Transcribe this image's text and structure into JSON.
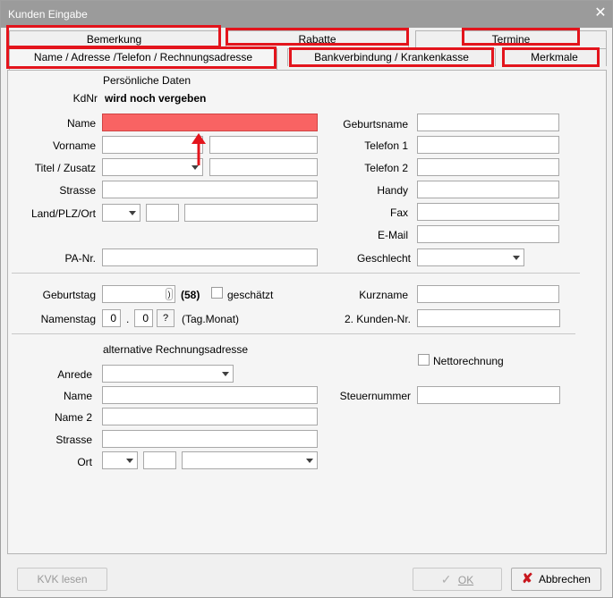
{
  "window": {
    "title": "Kunden Eingabe"
  },
  "tabs": {
    "row1": [
      "Bemerkung",
      "Rabatte",
      "Termine"
    ],
    "row2": [
      "Name / Adresse /Telefon / Rechnungsadresse",
      "Bankverbindung / Krankenkasse",
      "Merkmale"
    ]
  },
  "personal": {
    "section_title": "Persönliche Daten",
    "kdnr_label": "KdNr",
    "kdnr_value": "wird noch vergeben",
    "name_label": "Name",
    "vorname_label": "Vorname",
    "titel_label": "Titel / Zusatz",
    "strasse_label": "Strasse",
    "land_label": "Land/PLZ/Ort",
    "pa_label": "PA-Nr."
  },
  "right_fields": {
    "geburtsname": "Geburtsname",
    "telefon1": "Telefon 1",
    "telefon2": "Telefon 2",
    "handy": "Handy",
    "fax": "Fax",
    "email": "E-Mail",
    "geschlecht": "Geschlecht"
  },
  "dates": {
    "geburtstag_label": "Geburtstag",
    "age": "(58)",
    "geschaetzt_label": "geschätzt",
    "namenstag_label": "Namenstag",
    "namenstag_day": "0",
    "namenstag_sep": ".",
    "namenstag_month": "0",
    "help_button": "?",
    "tag_monat_hint": "(Tag.Monat)",
    "kurzname_label": "Kurzname",
    "kunden_nr2_label": "2. Kunden-Nr."
  },
  "alt_address": {
    "section_title": "alternative Rechnungsadresse",
    "anrede_label": "Anrede",
    "name_label": "Name",
    "name2_label": "Name 2",
    "strasse_label": "Strasse",
    "ort_label": "Ort",
    "nettorechnung_label": "Nettorechnung",
    "steuernummer_label": "Steuernummer"
  },
  "buttons": {
    "kvk": "KVK lesen",
    "ok": "OK",
    "abbrechen": "Abbrechen"
  },
  "colors": {
    "highlight_field": "#f96363",
    "annotation_red": "#e3141c",
    "titlebar": "#9b9b9b"
  }
}
